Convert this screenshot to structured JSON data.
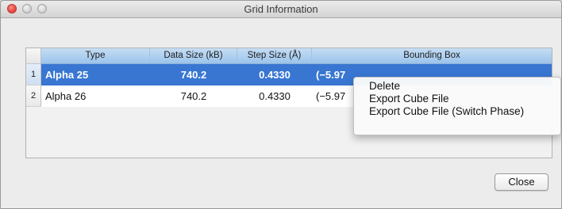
{
  "window": {
    "title": "Grid Information"
  },
  "table": {
    "columns": [
      "Type",
      "Data Size (kB)",
      "Step Size (Å)",
      "Bounding Box"
    ],
    "rows": [
      {
        "index": "1",
        "type": "Alpha 25",
        "data_size": "740.2",
        "step_size": "0.4330",
        "bounding_box": "(−5.97",
        "selected": true
      },
      {
        "index": "2",
        "type": "Alpha 26",
        "data_size": "740.2",
        "step_size": "0.4330",
        "bounding_box": "(−5.97",
        "selected": false
      }
    ]
  },
  "context_menu": {
    "items": [
      "Delete",
      "Export Cube File",
      "Export Cube File (Switch Phase)"
    ]
  },
  "buttons": {
    "close": "Close"
  },
  "colors": {
    "selection": "#3876d2",
    "header": "#a9cdef"
  }
}
